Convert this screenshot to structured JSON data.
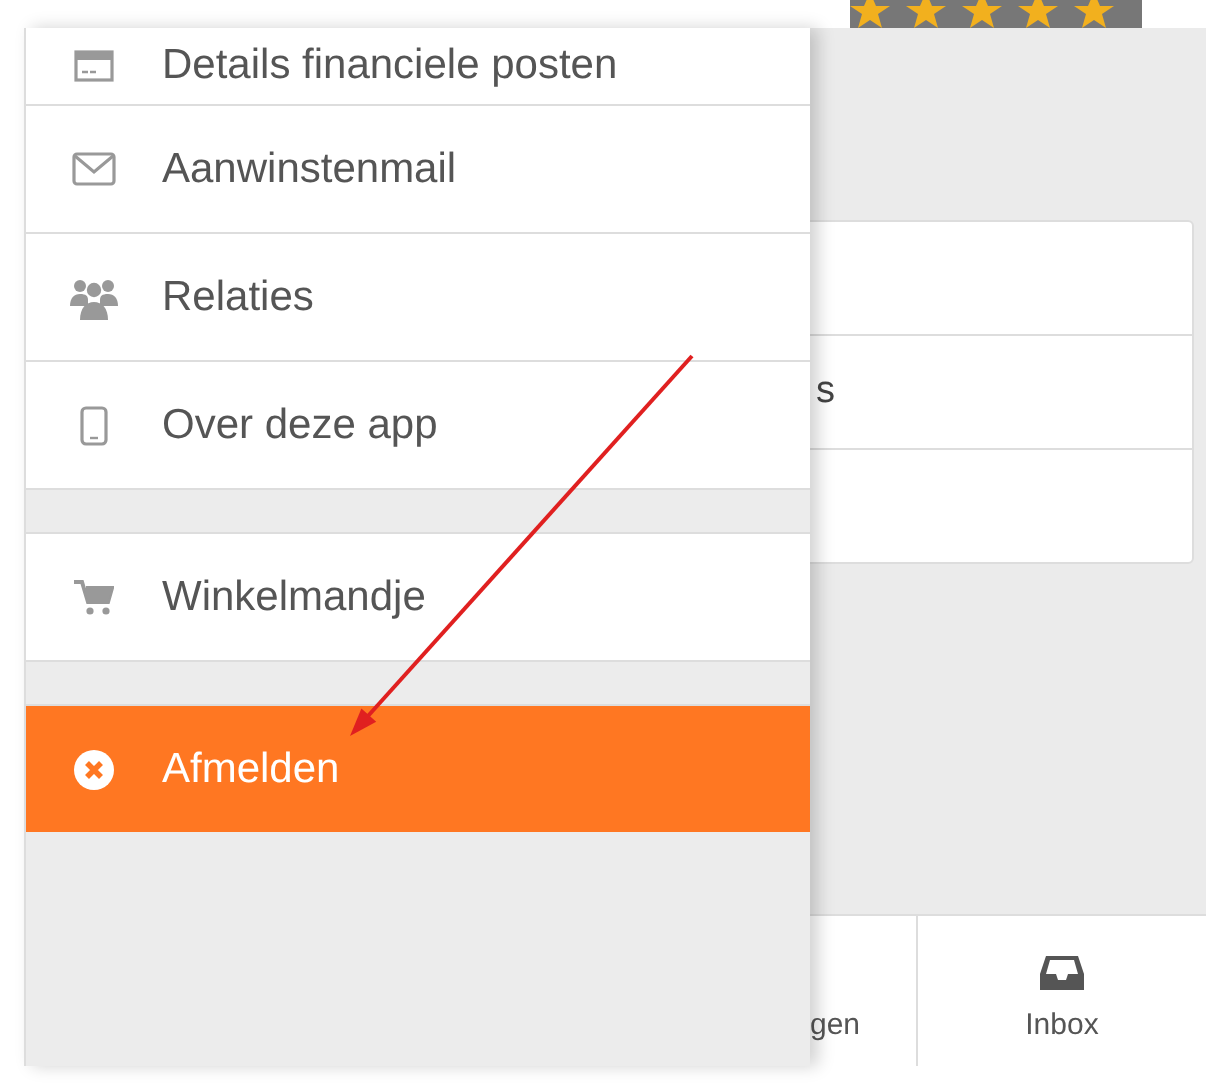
{
  "drawer": {
    "groups": [
      [
        {
          "label": "Details financiele posten",
          "selected": false
        },
        {
          "label": "Aanwinstenmail",
          "selected": false
        },
        {
          "label": "Relaties",
          "selected": false
        },
        {
          "label": "Over deze app",
          "selected": false
        }
      ],
      [
        {
          "label": "Winkelmandje",
          "selected": false
        }
      ],
      [
        {
          "label": "Afmelden",
          "selected": true
        }
      ]
    ]
  },
  "background": {
    "card_rows": [
      "",
      "s",
      ""
    ],
    "bottom_nav": [
      {
        "label": "gen"
      },
      {
        "label": "Inbox"
      }
    ]
  }
}
